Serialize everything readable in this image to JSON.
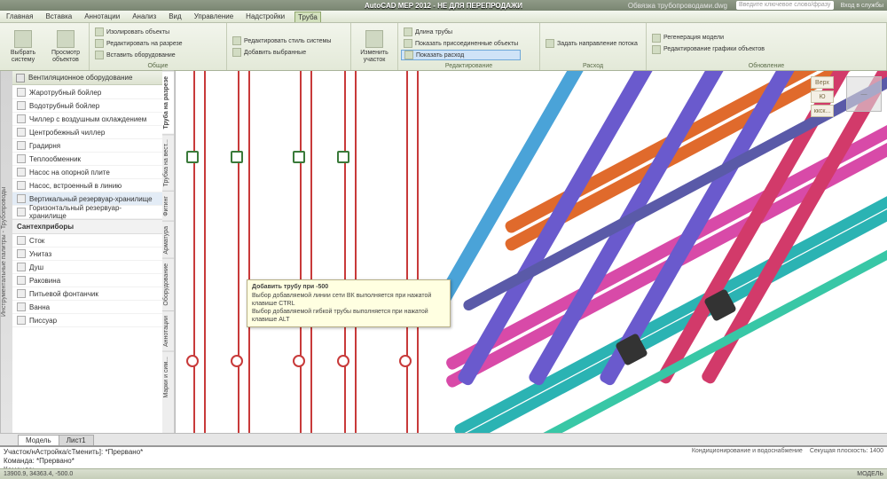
{
  "title": {
    "app": "AutoCAD MEP 2012 - НЕ ДЛЯ ПЕРЕПРОДАЖИ",
    "file": "Обвязка трубопроводами.dwg",
    "search_placeholder": "Введите ключевое слово/фразу",
    "login": "Вход в службы"
  },
  "menu": {
    "items": [
      "Главная",
      "Вставка",
      "Аннотации",
      "Анализ",
      "Вид",
      "Управление",
      "Надстройки"
    ],
    "active": "Труба",
    "extra": "Труба"
  },
  "ribbon": {
    "g1": {
      "label": "",
      "btn1": "Выбрать систему",
      "btn2": "Просмотр объектов"
    },
    "g2": {
      "label": "Общие",
      "r1": "Изолировать объекты",
      "r2": "Редактировать на разрезе",
      "r3": "Вставить оборудование"
    },
    "g3": {
      "label": "",
      "r1": "Редактировать стиль системы",
      "r2": "Добавить выбранные"
    },
    "g4": {
      "label": "",
      "btn": "Изменить участок"
    },
    "g5": {
      "label": "Редактирование",
      "r1": "Длина трубы",
      "r2": "Показать присоединенные объекты",
      "r3": "Показать расход"
    },
    "g6": {
      "label": "Расход",
      "r1": "Задать направление потока"
    },
    "g7": {
      "label": "Обновление",
      "r1": "Регенерация модели",
      "r2": "Редактирование графики объектов"
    }
  },
  "palette": {
    "strip": "Инструментальные палитры - Трубопроводы",
    "tabs": [
      "Труба на разрезе",
      "Трубка на вест...",
      "Фитинг",
      "Арматура",
      "Оборудование",
      "Аннотации",
      "Марки и сим..."
    ],
    "active_tab": 0,
    "header": "Вентиляционное оборудование",
    "groups": [
      {
        "items": [
          "Жаротрубный бойлер",
          "Водотрубный бойлер",
          "Чиллер с воздушным охлаждением",
          "Центробежный чиллер",
          "Градирня",
          "Теплообменник",
          "Насос на опорной плите",
          "Насос, встроенный в линию",
          "Вертикальный резервуар-хранилище",
          "Горизонтальный резервуар-хранилище"
        ]
      },
      {
        "title": "Сантехприборы",
        "items": [
          "Сток",
          "Унитаз",
          "Душ",
          "Раковина",
          "Питьевой фонтанчик",
          "Ванна",
          "Писсуар"
        ]
      }
    ],
    "selected": "Вертикальный резервуар-хранилище"
  },
  "nav_badges": [
    "Верх",
    "Ю",
    "ккск..."
  ],
  "tooltip": {
    "title": "Добавить трубу при -500",
    "l1": "Выбор добавляемой линии сети ВК выполняется при нажатой клавише CTRL",
    "l2": "Выбор добавляемой гибкой трубы выполняется при нажатой клавише ALT"
  },
  "modeltabs": {
    "tabs": [
      "Модель",
      "Лист1"
    ],
    "active": 0
  },
  "cmd": {
    "l1": "Участок/нАстройка/сТменить]: *Прервано*",
    "l2": "Команда: *Прервано*",
    "l3": "Команда:",
    "status1": "Кондиционирование и водоснабжение",
    "status2": "Секущая плоскость: 1400"
  },
  "statusbar": {
    "coords": "13900.9, 34363.4, -500.0",
    "right": "МОДЕЛЬ"
  },
  "viewcube": "—"
}
